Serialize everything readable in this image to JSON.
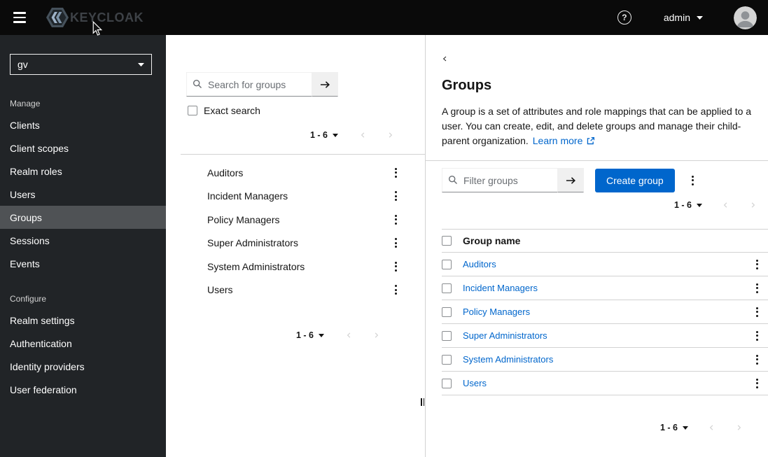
{
  "topbar": {
    "brand": "KEYCLOAK",
    "help_icon": "?",
    "username": "admin"
  },
  "sidebar": {
    "realm": "gv",
    "manage_label": "Manage",
    "manage_items": [
      "Clients",
      "Client scopes",
      "Realm roles",
      "Users",
      "Groups",
      "Sessions",
      "Events"
    ],
    "selected_item": "Groups",
    "configure_label": "Configure",
    "configure_items": [
      "Realm settings",
      "Authentication",
      "Identity providers",
      "User federation"
    ]
  },
  "tree": {
    "search_placeholder": "Search for groups",
    "exact_search_label": "Exact search",
    "pagination": "1 - 6",
    "groups": [
      "Auditors",
      "Incident Managers",
      "Policy Managers",
      "Super Administrators",
      "System Administrators",
      "Users"
    ]
  },
  "main": {
    "title": "Groups",
    "description": "A group is a set of attributes and role mappings that can be applied to a user. You can create, edit, and delete groups and manage their child-parent organization.",
    "learn_more": "Learn more",
    "filter_placeholder": "Filter groups",
    "create_button": "Create group",
    "pagination": "1 - 6",
    "column_header": "Group name",
    "rows": [
      "Auditors",
      "Incident Managers",
      "Policy Managers",
      "Super Administrators",
      "System Administrators",
      "Users"
    ]
  },
  "colors": {
    "primary": "#0066cc",
    "link": "#0066cc",
    "topbar_bg": "#0a0a0a",
    "sidebar_bg": "#212427",
    "sidebar_selected": "#4f5255"
  }
}
